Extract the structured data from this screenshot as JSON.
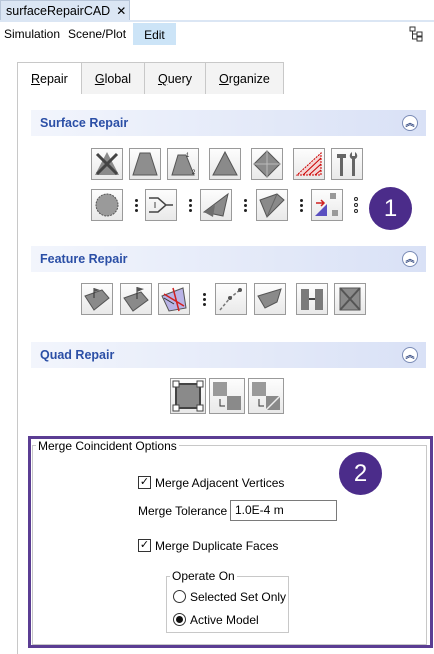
{
  "app": {
    "tab_title": "surfaceRepairCAD",
    "close_glyph": "✕"
  },
  "menubar": {
    "items": [
      "Simulation",
      "Scene/Plot",
      "Edit"
    ],
    "active": "Edit",
    "right_icon": "tree-structure-icon"
  },
  "tabs": {
    "items": [
      {
        "label": "Repair",
        "underline": "R",
        "rest": "epair",
        "active": true
      },
      {
        "label": "Global",
        "underline": "G",
        "rest": "lobal",
        "active": false
      },
      {
        "label": "Query",
        "underline": "Q",
        "rest": "uery",
        "active": false
      },
      {
        "label": "Organize",
        "underline": "O",
        "rest": "rganize",
        "active": false
      }
    ]
  },
  "sections": {
    "surface_repair": {
      "title": "Surface Repair",
      "collapse_glyph": "︽",
      "row1_icons": [
        "delete-faces-icon",
        "fill-hole-icon",
        "fill-hole-edges-icon",
        "triangle-icon",
        "diamond-icon",
        "hatched-triangle-icon",
        "repair-tools-icon"
      ],
      "row2_icons": [
        "zip-edges-icon",
        "merge-edges-icon",
        "split-faces-icon",
        "surface-patch-icon",
        "swap-faces-icon"
      ]
    },
    "feature_repair": {
      "title": "Feature Repair",
      "collapse_glyph": "︽",
      "icons": [
        "feature-edges-icon",
        "feature-flag-icon",
        "feature-select-icon",
        "feature-curve-icon",
        "feature-surface-icon",
        "feature-merge-icon",
        "feature-clear-icon"
      ]
    },
    "quad_repair": {
      "title": "Quad Repair",
      "collapse_glyph": "︽",
      "icons": [
        "quad-face-icon",
        "quad-merge-icon",
        "quad-split-icon"
      ]
    }
  },
  "badges": {
    "one": "1",
    "two": "2"
  },
  "merge_options": {
    "title": "Merge Coincident Options",
    "merge_vertices": {
      "label": "Merge Adjacent Vertices",
      "checked": true
    },
    "tolerance": {
      "label": "Merge Tolerance",
      "value": "1.0E-4 m"
    },
    "merge_faces": {
      "label": "Merge Duplicate Faces",
      "checked": true
    },
    "operate_on": {
      "title": "Operate On",
      "options": [
        {
          "label": "Selected Set Only",
          "selected": false
        },
        {
          "label": "Active Model",
          "selected": true
        }
      ]
    }
  },
  "colors": {
    "accent_purple": "#4b2c8a",
    "section_title": "#2b4fa6",
    "menu_active": "#cce4f7",
    "tab_background": "#dbe6f4"
  }
}
